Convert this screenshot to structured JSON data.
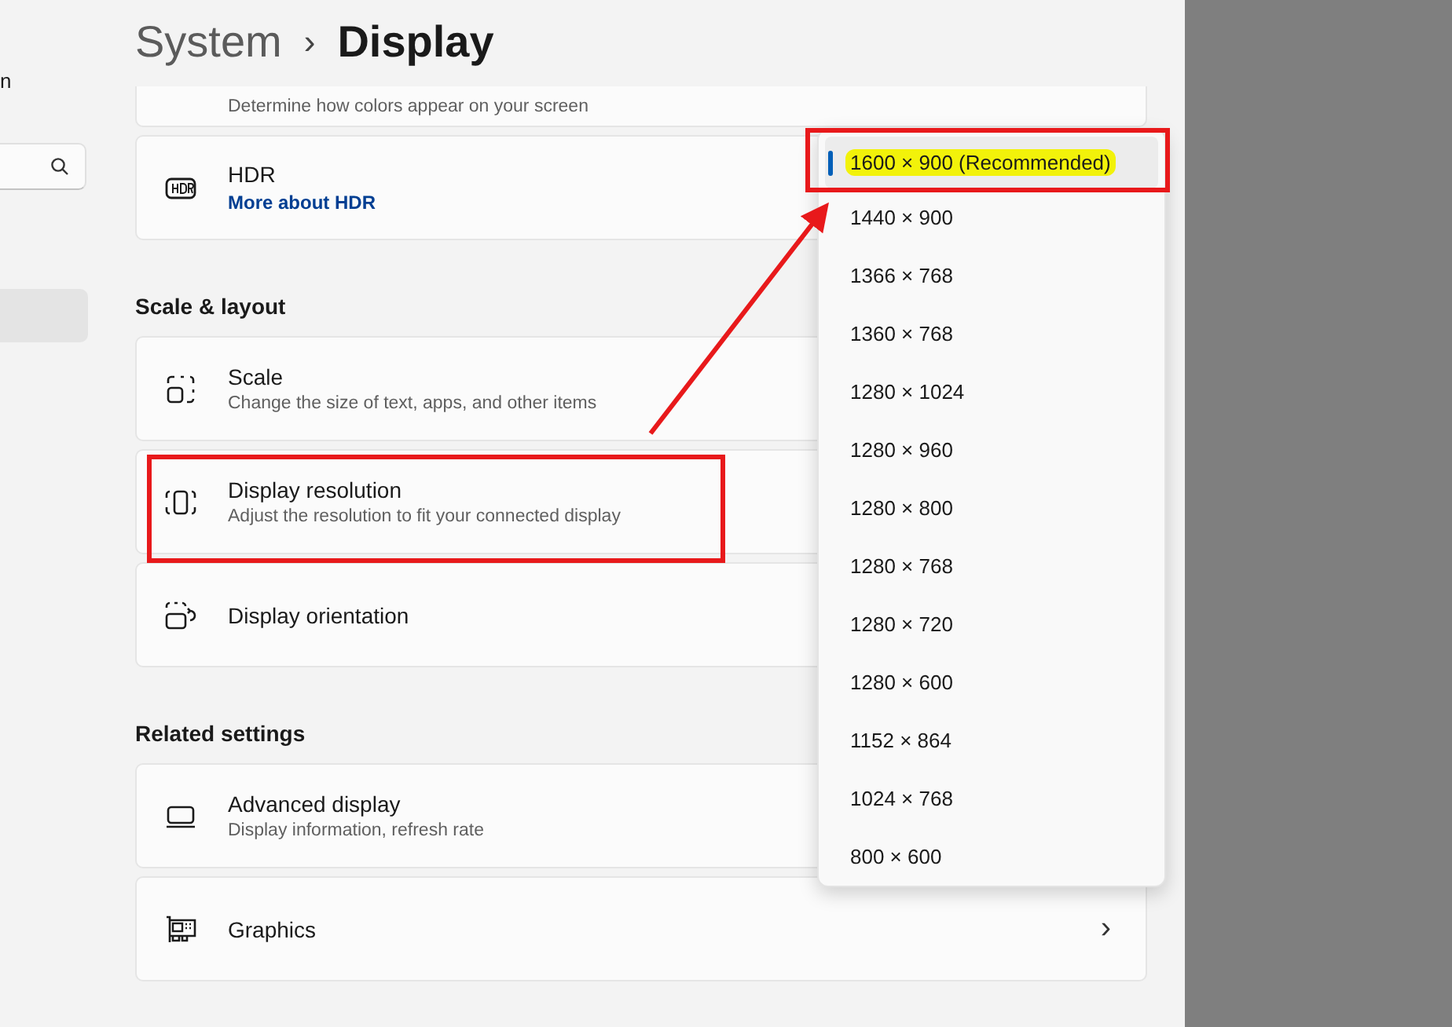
{
  "sidebar": {
    "text_fragment": "n",
    "selected_item": {
      "selected": true
    }
  },
  "breadcrumb": {
    "parent": "System",
    "separator": "›",
    "current": "Display"
  },
  "sections": [
    {
      "cards": [
        {
          "kind": "partial",
          "description": "Determine how colors appear on your screen"
        },
        {
          "kind": "hdr",
          "title": "HDR",
          "link": "More about HDR"
        }
      ]
    },
    {
      "heading": "Scale & layout",
      "cards": [
        {
          "kind": "scale",
          "title": "Scale",
          "description": "Change the size of text, apps, and other items"
        },
        {
          "kind": "resolution",
          "title": "Display resolution",
          "description": "Adjust the resolution to fit your connected display"
        },
        {
          "kind": "orientation",
          "title": "Display orientation"
        }
      ]
    },
    {
      "heading": "Related settings",
      "cards": [
        {
          "kind": "advanced",
          "title": "Advanced display",
          "description": "Display information, refresh rate"
        },
        {
          "kind": "graphics",
          "title": "Graphics",
          "chevron": "›"
        }
      ]
    }
  ],
  "resolution_menu": [
    {
      "label": "1600 × 900 (Recommended)",
      "selected": true,
      "highlighted": true
    },
    {
      "label": "1440 × 900",
      "selected": false,
      "highlighted": false
    },
    {
      "label": "1366 × 768",
      "selected": false,
      "highlighted": false
    },
    {
      "label": "1360 × 768",
      "selected": false,
      "highlighted": false
    },
    {
      "label": "1280 × 1024",
      "selected": false,
      "highlighted": false
    },
    {
      "label": "1280 × 960",
      "selected": false,
      "highlighted": false
    },
    {
      "label": "1280 × 800",
      "selected": false,
      "highlighted": false
    },
    {
      "label": "1280 × 768",
      "selected": false,
      "highlighted": false
    },
    {
      "label": "1280 × 720",
      "selected": false,
      "highlighted": false
    },
    {
      "label": "1280 × 600",
      "selected": false,
      "highlighted": false
    },
    {
      "label": "1152 × 864",
      "selected": false,
      "highlighted": false
    },
    {
      "label": "1024 × 768",
      "selected": false,
      "highlighted": false
    },
    {
      "label": "800 × 600",
      "selected": false,
      "highlighted": false
    }
  ]
}
